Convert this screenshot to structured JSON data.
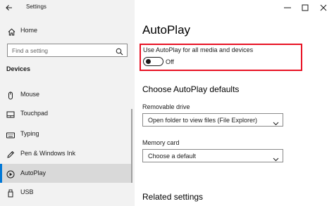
{
  "window": {
    "title": "Settings"
  },
  "sidebar": {
    "home_label": "Home",
    "search_placeholder": "Find a setting",
    "section_title": "Devices",
    "items": [
      {
        "label": "Mouse",
        "icon": "mouse-icon"
      },
      {
        "label": "Touchpad",
        "icon": "touchpad-icon"
      },
      {
        "label": "Typing",
        "icon": "keyboard-icon"
      },
      {
        "label": "Pen & Windows Ink",
        "icon": "pen-icon"
      },
      {
        "label": "AutoPlay",
        "icon": "autoplay-icon",
        "selected": true
      },
      {
        "label": "USB",
        "icon": "usb-icon"
      }
    ]
  },
  "main": {
    "title": "AutoPlay",
    "toggle": {
      "label": "Use AutoPlay for all media and devices",
      "state_text": "Off",
      "on": false
    },
    "defaults_heading": "Choose AutoPlay defaults",
    "removable_drive": {
      "label": "Removable drive",
      "value": "Open folder to view files (File Explorer)"
    },
    "memory_card": {
      "label": "Memory card",
      "value": "Choose a default"
    },
    "related_heading": "Related settings"
  },
  "colors": {
    "accent": "#0078d7",
    "highlight": "#e81123",
    "sidebar_bg": "#f2f2f2",
    "selected_bg": "#d9d9d9"
  }
}
